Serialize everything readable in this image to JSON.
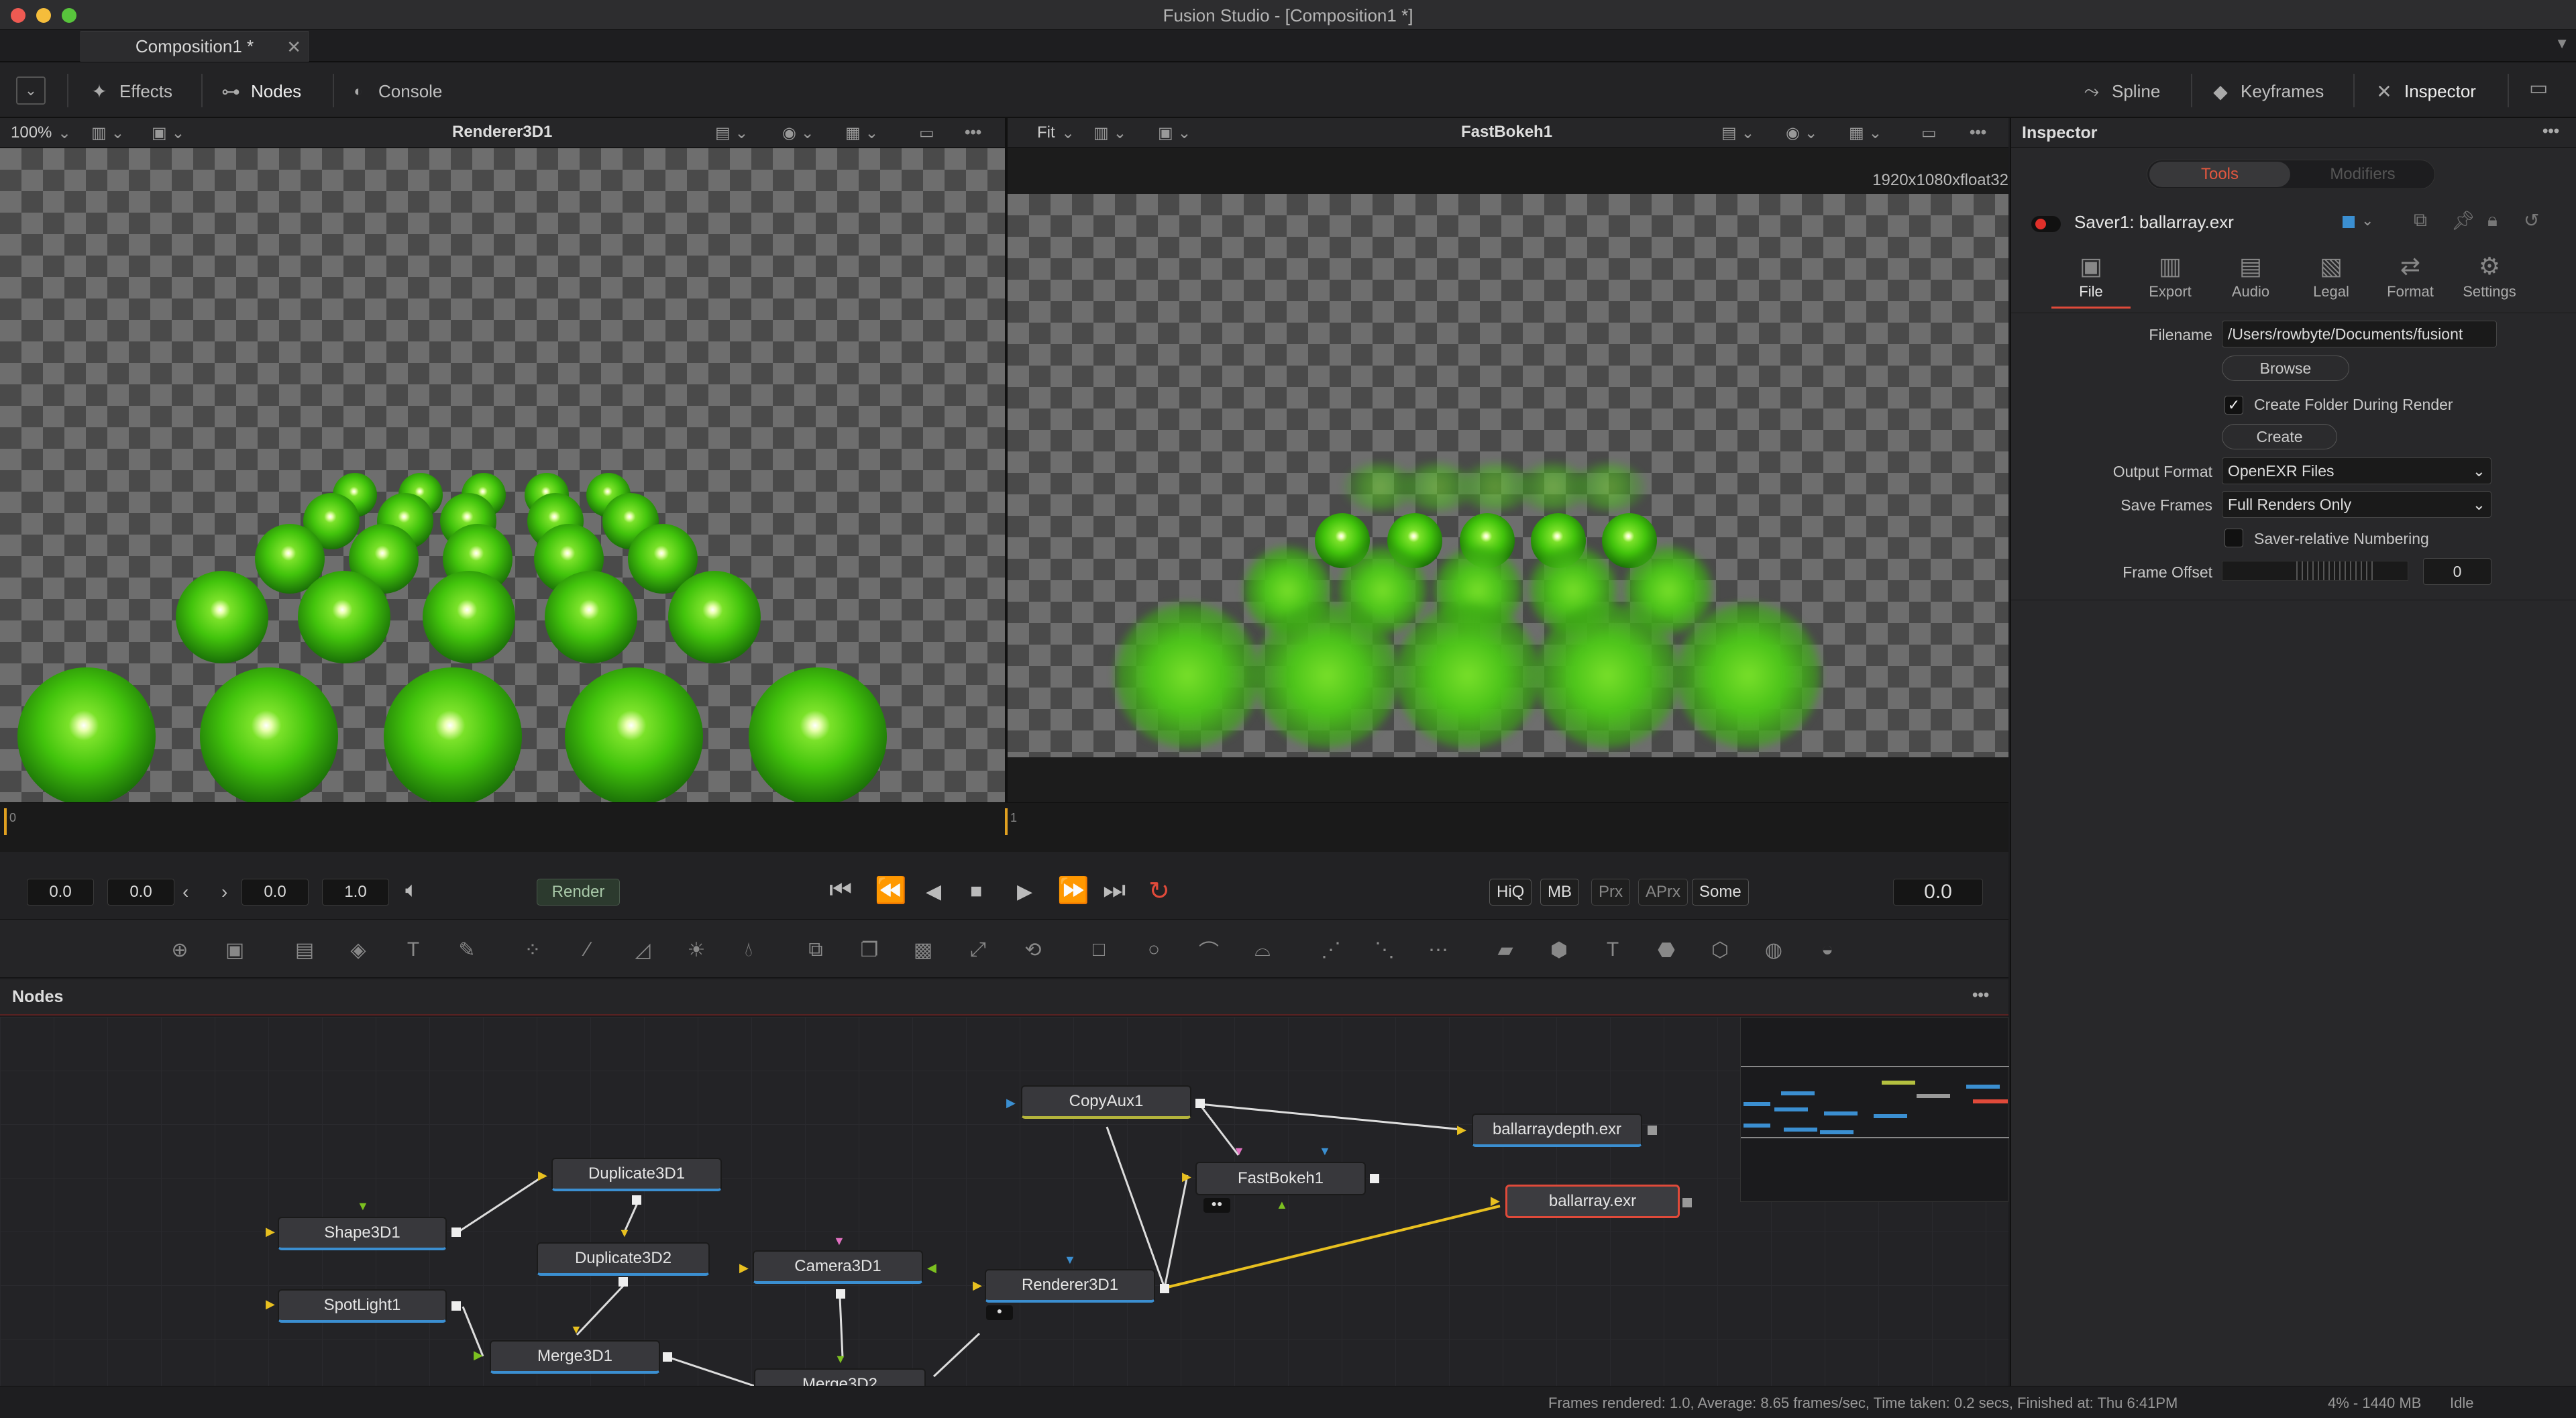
{
  "window": {
    "title": "Fusion Studio - [Composition1 *]",
    "tab_label": "Composition1 *",
    "tab_close": "✕"
  },
  "toolbar": {
    "effects": "Effects",
    "nodes": "Nodes",
    "console": "Console",
    "spline": "Spline",
    "keyframes": "Keyframes",
    "inspector": "Inspector"
  },
  "viewer_left": {
    "zoom": "100%",
    "name": "Renderer3D1"
  },
  "viewer_right": {
    "zoom": "Fit",
    "name": "FastBokeh1",
    "resolution": "1920x1080xfloat32"
  },
  "timeline": {
    "start_left": "0",
    "start_right": "1"
  },
  "transport": {
    "global_start": "0.0",
    "render_start": "0.0",
    "render_end": "0.0",
    "step": "1.0",
    "render_label": "Render",
    "current_time": "0.0",
    "quality_buttons": [
      "HiQ",
      "MB",
      "Prx",
      "APrx",
      "Some"
    ]
  },
  "nodes_panel": {
    "title": "Nodes",
    "nodes": [
      "Shape3D1",
      "SpotLight1",
      "Duplicate3D1",
      "Duplicate3D2",
      "Merge3D1",
      "Merge3D2",
      "Camera3D1",
      "Renderer3D1",
      "CopyAux1",
      "FastBokeh1",
      "ballarraydepth.exr",
      "ballarray.exr"
    ]
  },
  "inspector": {
    "title": "Inspector",
    "tab_tools": "Tools",
    "tab_modifiers": "Modifiers",
    "tool_name": "Saver1: ballarray.exr",
    "subtabs": [
      "File",
      "Export",
      "Audio",
      "Legal",
      "Format",
      "Settings"
    ],
    "filename_label": "Filename",
    "filename_value": "/Users/rowbyte/Documents/fusiont",
    "browse": "Browse",
    "create_folder_label": "Create Folder During Render",
    "create_folder_checked": true,
    "create": "Create",
    "output_format_label": "Output Format",
    "output_format_value": "OpenEXR Files",
    "save_frames_label": "Save Frames",
    "save_frames_value": "Full Renders Only",
    "saver_relative_label": "Saver-relative Numbering",
    "frame_offset_label": "Frame Offset",
    "frame_offset_value": "0"
  },
  "status": {
    "message": "Frames rendered: 1.0,  Average: 8.65 frames/sec,  Time taken: 0.2 secs,  Finished at: Thu 6:41PM",
    "memory": "4% - 1440 MB",
    "state": "Idle"
  },
  "colors": {
    "accent_red": "#e04a3a",
    "ball_green": "#42c40c",
    "connection_yellow": "#e8c020",
    "node_blue": "#3b8fd1"
  }
}
